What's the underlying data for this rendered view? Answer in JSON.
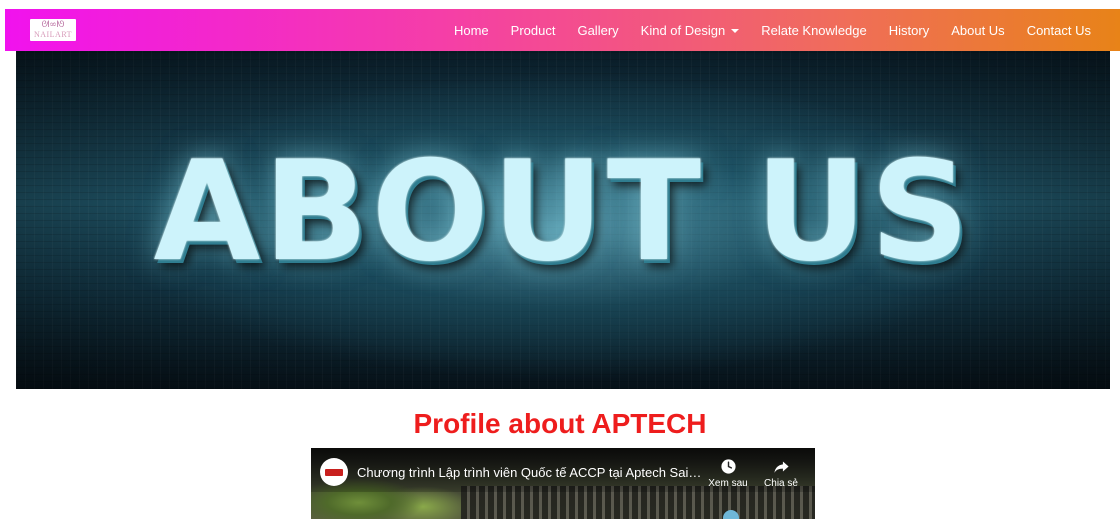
{
  "navbar": {
    "brand": {
      "glyph": "ᘛ∞ᘚ",
      "text": "NAILART"
    },
    "items": [
      {
        "label": "Home"
      },
      {
        "label": "Product"
      },
      {
        "label": "Gallery"
      },
      {
        "label": "Kind of Design",
        "dropdown": true
      },
      {
        "label": "Relate Knowledge"
      },
      {
        "label": "History"
      },
      {
        "label": "About Us"
      },
      {
        "label": "Contact Us"
      }
    ]
  },
  "hero": {
    "title": "ABOUT US"
  },
  "profile": {
    "title": "Profile about APTECH",
    "video": {
      "title": "Chương trình Lập trình viên Quốc tế ACCP tại Aptech Saig...",
      "watch_later_label": "Xem sau",
      "share_label": "Chia sẻ"
    }
  }
}
